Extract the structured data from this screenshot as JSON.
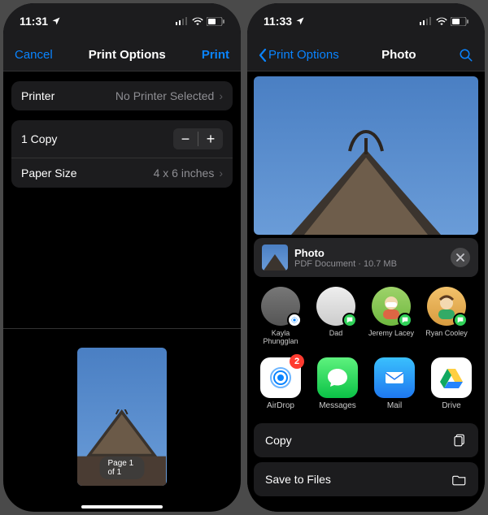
{
  "left": {
    "status": {
      "time": "11:31",
      "location_arrow": true
    },
    "nav": {
      "cancel": "Cancel",
      "title": "Print Options",
      "print": "Print"
    },
    "printer_row": {
      "label": "Printer",
      "value": "No Printer Selected"
    },
    "copies_row": {
      "label": "1 Copy"
    },
    "paper_row": {
      "label": "Paper Size",
      "value": "4 x 6 inches"
    },
    "preview": {
      "page_label": "Page 1 of 1"
    }
  },
  "right": {
    "status": {
      "time": "11:33",
      "location_arrow": true
    },
    "nav": {
      "back": "Print Options",
      "title": "Photo"
    },
    "share_item": {
      "name": "Photo",
      "meta": "PDF Document · 10.7 MB"
    },
    "contacts": [
      {
        "name": "Kayla Phungglan"
      },
      {
        "name": "Dad"
      },
      {
        "name": "Jeremy Lacey"
      },
      {
        "name": "Ryan Cooley"
      }
    ],
    "apps": [
      {
        "name": "AirDrop",
        "badge": "2"
      },
      {
        "name": "Messages"
      },
      {
        "name": "Mail"
      },
      {
        "name": "Drive"
      }
    ],
    "actions": {
      "copy": "Copy",
      "save": "Save to Files"
    }
  }
}
